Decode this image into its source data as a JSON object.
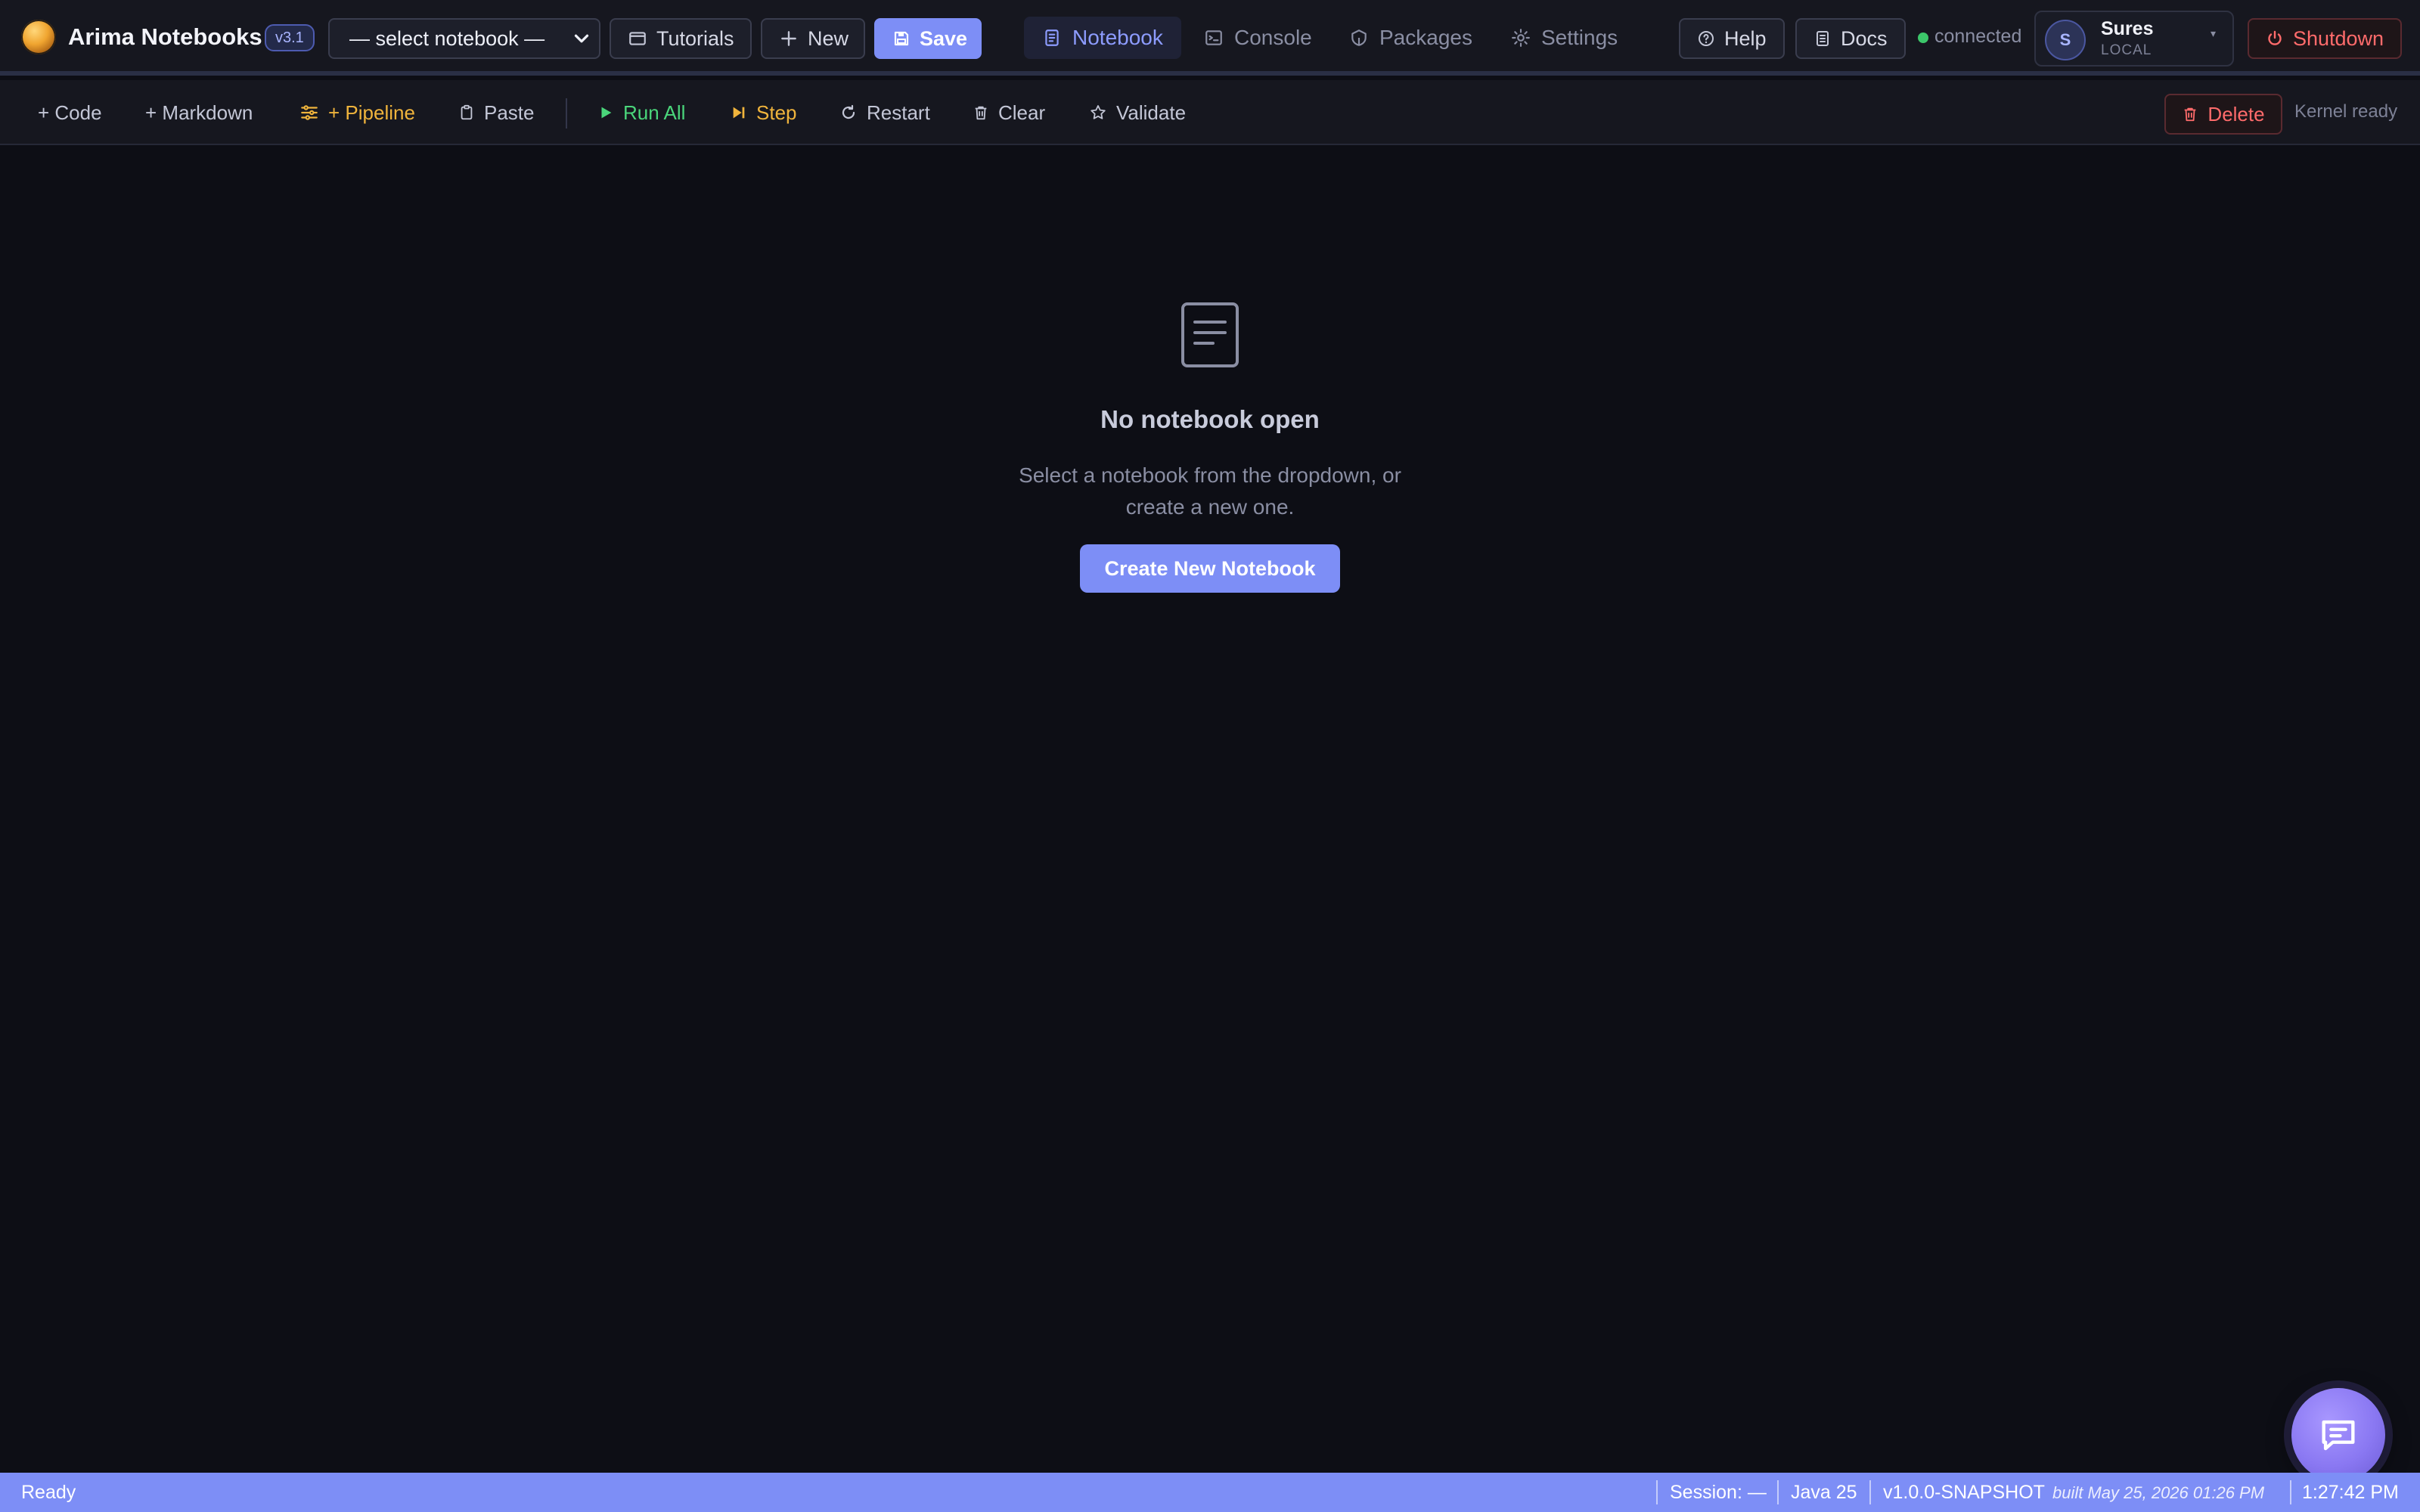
{
  "app": {
    "title": "Arima Notebooks",
    "version": "v3.1"
  },
  "header": {
    "notebook_select": {
      "value": "— select notebook —"
    },
    "tutorials_label": "Tutorials",
    "new_label": "New",
    "save_label": "Save",
    "nav": [
      {
        "label": "Notebook",
        "icon": "notebook-icon",
        "active": true
      },
      {
        "label": "Console",
        "icon": "terminal-icon",
        "active": false
      },
      {
        "label": "Packages",
        "icon": "package-icon",
        "active": false
      },
      {
        "label": "Settings",
        "icon": "gear-icon",
        "active": false
      }
    ],
    "help_label": "Help",
    "docs_label": "Docs",
    "connection_status": "connected",
    "user": {
      "initial": "S",
      "name": "Sures",
      "role": "LOCAL"
    },
    "shutdown_label": "Shutdown"
  },
  "toolbar": {
    "code_label": "+ Code",
    "markdown_label": "+ Markdown",
    "pipeline_label": "+ Pipeline",
    "paste_label": "Paste",
    "run_all_label": "Run All",
    "step_label": "Step",
    "restart_label": "Restart",
    "clear_label": "Clear",
    "validate_label": "Validate",
    "delete_label": "Delete",
    "kernel_status": "Kernel ready"
  },
  "empty_state": {
    "title": "No notebook open",
    "description": "Select a notebook from the dropdown, or create a new one.",
    "button_label": "Create New Notebook"
  },
  "statusbar": {
    "state": "Ready",
    "session": "Session: —",
    "java": "Java 25",
    "version": "v1.0.0-SNAPSHOT",
    "built": "built May 25, 2026 01:26 PM",
    "clock": "1:27:42 PM"
  },
  "colors": {
    "accent": "#7d8ef6",
    "background": "#0d0e15",
    "success": "#3cc76a",
    "warning": "#f0b43c",
    "danger": "#ff6b6b"
  }
}
